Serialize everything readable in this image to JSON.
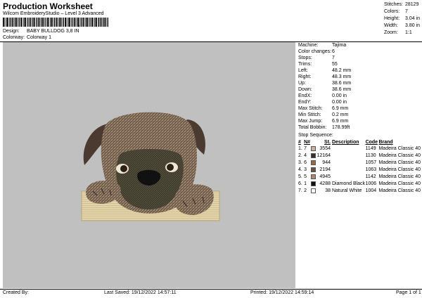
{
  "header": {
    "title": "Production Worksheet",
    "subtitle": "Wilcom EmbroideryStudio – Level 3 Advanced",
    "barcode_separator": ",",
    "design_label": "Design:",
    "design_value": "BABY BULLDOG 3,8 IN",
    "colorway_label": "Colorway:",
    "colorway_value": "Colorway 1"
  },
  "top_stats": [
    {
      "label": "Stitches:",
      "value": "28129"
    },
    {
      "label": "Colors:",
      "value": "7"
    },
    {
      "label": "Height:",
      "value": "3.04 in"
    },
    {
      "label": "Width:",
      "value": "3.80 in"
    },
    {
      "label": "Zoom:",
      "value": "1:1"
    }
  ],
  "details": [
    {
      "label": "Machine:",
      "value": "Tajima"
    },
    {
      "label": "Color changes:",
      "value": "6"
    },
    {
      "label": "Stops:",
      "value": "7"
    },
    {
      "label": "Trims:",
      "value": "55"
    },
    {
      "label": "Left:",
      "value": "48.2 mm"
    },
    {
      "label": "Right:",
      "value": "48.3 mm"
    },
    {
      "label": "Up:",
      "value": "38.6 mm"
    },
    {
      "label": "Down:",
      "value": "38.6 mm"
    },
    {
      "label": "EndX:",
      "value": "0.00 in"
    },
    {
      "label": "EndY:",
      "value": "0.00 in"
    },
    {
      "label": "Max Stitch:",
      "value": "6.9 mm"
    },
    {
      "label": "Min Stitch:",
      "value": "0.2 mm"
    },
    {
      "label": "Max Jump:",
      "value": "6.9 mm"
    },
    {
      "label": "Total Bobbin:",
      "value": "178.99ft"
    }
  ],
  "stop_sequence": {
    "title": "Stop Sequence:",
    "headers": [
      "#",
      "N#",
      "",
      "St.",
      "Description",
      "Code",
      "Brand"
    ],
    "rows": [
      {
        "num": "1.",
        "n": "7",
        "color": "#c8b49a",
        "st": "3554",
        "desc": "",
        "code": "1149",
        "brand": "Madeira Classic 40"
      },
      {
        "num": "2.",
        "n": "4",
        "color": "#3a2e28",
        "st": "12164",
        "desc": "",
        "code": "1130",
        "brand": "Madeira Classic 40"
      },
      {
        "num": "3.",
        "n": "6",
        "color": "#9a6a44",
        "st": "944",
        "desc": "",
        "code": "1057",
        "brand": "Madeira Classic 40"
      },
      {
        "num": "4.",
        "n": "3",
        "color": "#6a5040",
        "st": "2194",
        "desc": "",
        "code": "1063",
        "brand": "Madeira Classic 40"
      },
      {
        "num": "5.",
        "n": "5",
        "color": "#a88a74",
        "st": "4945",
        "desc": "",
        "code": "1142",
        "brand": "Madeira Classic 40"
      },
      {
        "num": "6.",
        "n": "1",
        "color": "#111111",
        "st": "4288",
        "desc": "Diamond Black",
        "code": "1006",
        "brand": "Madeira Classic 40"
      },
      {
        "num": "7.",
        "n": "2",
        "color": "#ffffff",
        "st": "38",
        "desc": "Natural White",
        "code": "1004",
        "brand": "Madeira Classic 40"
      }
    ]
  },
  "footer": {
    "created_by": "Created By:",
    "last_saved": "Last Saved: 19/12/2022 14:57:11",
    "printed": "Printed: 19/12/2022 14:59:14",
    "page": "Page 1 of 1"
  }
}
